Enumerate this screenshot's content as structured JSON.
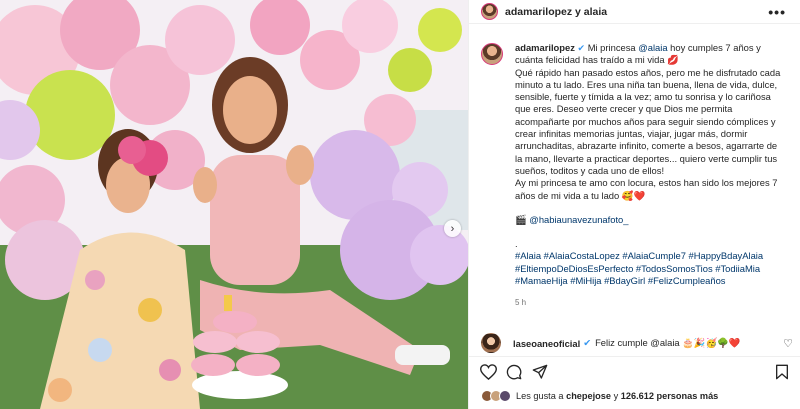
{
  "header": {
    "username": "adamarilopez y alaia",
    "more_label": "•••"
  },
  "post": {
    "author": "adamarilopez",
    "verified_icon": "verified-badge",
    "line1_a": "Mi princesa",
    "mention_alaia": "@alaia",
    "line1_b": "hoy cumples 7 años y cuánta felicidad has traído a mi vida 💋",
    "paragraph1": "Qué rápido han pasado estos años, pero me he disfrutado cada minuto a tu lado. Eres una niña tan buena, llena de vida, dulce, sensible, fuerte y tímida a la vez; amo tu sonrisa y lo cariñosa que eres. Deseo verte crecer y que Dios me permita acompañarte por muchos años para seguir siendo cómplices y crear infinitas memorias juntas, viajar, jugar más, dormir arrunchaditas, abrazarte infinito, comerte a besos, agarrarte de la mano, llevarte a practicar deportes... quiero verte cumplir tus sueños, toditos y cada uno de ellos!",
    "paragraph2": "Ay mi princesa te amo con locura, estos han sido los mejores 7 años de mi vida a tu lado 🥰❤️",
    "photo_credit_icon": "🎬",
    "photo_credit": "@habiaunavezunafoto_",
    "dot": ".",
    "hashtags": "#Alaia #AlaiaCostaLopez #AlaiaCumple7 #HappyBdayAlaia #EltiempoDeDiosEsPerfecto #TodosSomosTios #TodiiaMia #MamaeHija #MiHija #BdayGirl #FelizCumpleaños",
    "time_ago": "5 h"
  },
  "comment": {
    "username": "laseoaneoficial",
    "verified_icon": "verified-badge",
    "text": "Feliz cumple @alaia 🎂🎉🥳🌳❤️"
  },
  "likes": {
    "prefix": "Les gusta a",
    "user": "chepejose",
    "middle": "y",
    "count": "126.612 personas más"
  }
}
